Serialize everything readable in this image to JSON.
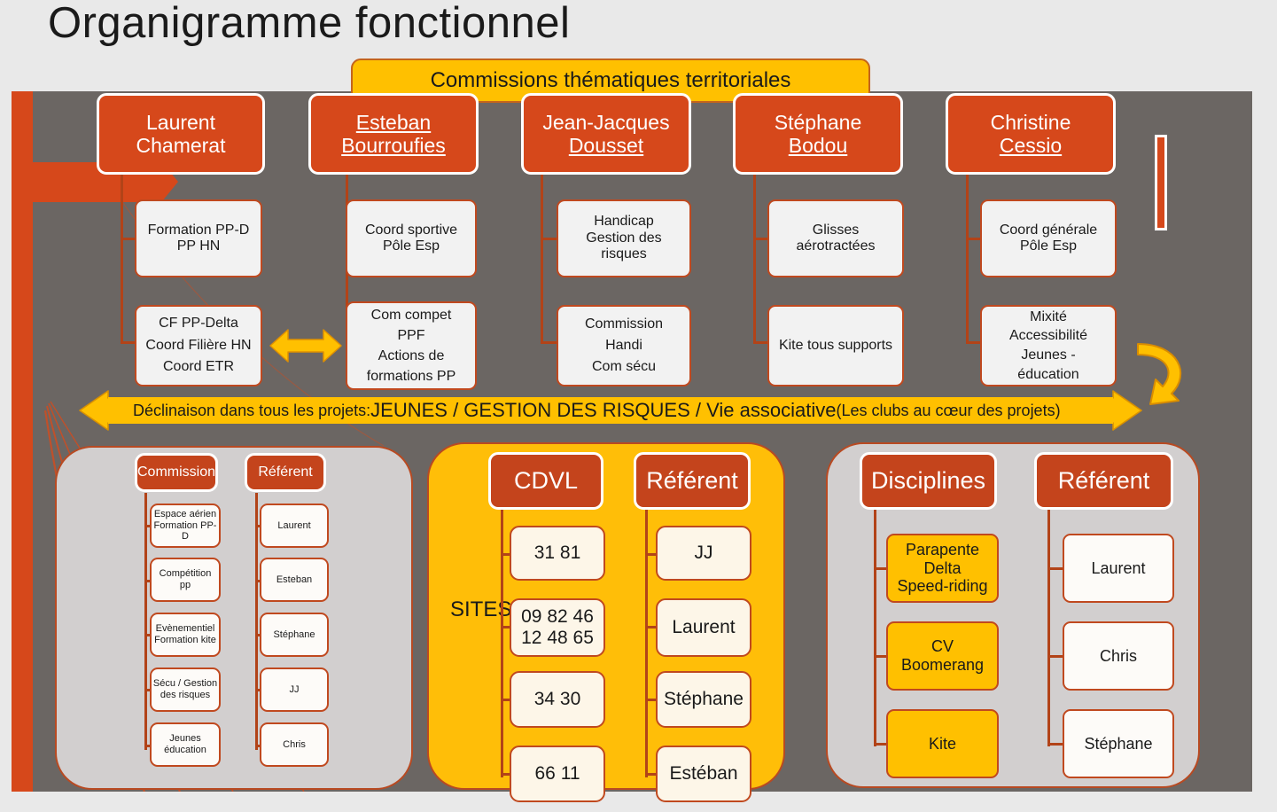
{
  "page": {
    "title": "Organigramme fonctionnel",
    "colors": {
      "orange": "#D6481B",
      "yellow": "#FFC000",
      "gray_stage": "#6B6663",
      "panel_gray": "#D2CFCF",
      "panel_yellow": "#FFBE08",
      "white_box": "#F2F2F2",
      "cream_box": "#FDF6E8",
      "connector": "#B24318",
      "background": "#E9E9E9"
    }
  },
  "top_banner": {
    "label": "Commissions thématiques territoriales"
  },
  "columns": [
    {
      "name": "Laurent Chamerat",
      "sub1": "Formation PP-D\nPP HN",
      "sub1_lines": [
        "Formation PP-D",
        "PP HN"
      ],
      "sub2_lines": [
        "CF PP-Delta",
        "Coord Filière HN",
        "Coord ETR"
      ]
    },
    {
      "name": "Esteban Bourroufies",
      "sub1_lines": [
        "Coord sportive",
        "Pôle Esp"
      ],
      "sub2_lines": [
        "Com compet",
        "PPF",
        "Actions de",
        "formations PP"
      ]
    },
    {
      "name": "Jean-Jacques Dousset",
      "sub1_lines": [
        "Handicap",
        "Gestion des",
        "risques"
      ],
      "sub2_lines": [
        "Commission",
        "Handi",
        "Com sécu"
      ]
    },
    {
      "name": "Stéphane Bodou",
      "sub1_lines": [
        "Glisses",
        "aérotractées"
      ],
      "sub2_lines": [
        "Kite tous supports"
      ]
    },
    {
      "name": "Christine Cessio",
      "sub1_lines": [
        "Coord générale",
        "Pôle Esp"
      ],
      "sub2_lines": [
        "Mixité",
        "Accessibilité",
        "Jeunes -",
        "éducation"
      ]
    }
  ],
  "column_names": {
    "c1_l1": "Laurent",
    "c1_l2": "Chamerat",
    "c2_l1": "Esteban",
    "c2_l2": "Bourroufies",
    "c3_l1": "Jean-Jacques",
    "c3_l2": "Dousset",
    "c4_l1": "Stéphane",
    "c4_l2": "Bodou",
    "c5_l1": "Christine",
    "c5_l2": "Cessio"
  },
  "row1_boxes": {
    "b1": "Formation PP-D\nPP HN",
    "b2": "Coord sportive\nPôle Esp",
    "b3": "Handicap\nGestion des\nrisques",
    "b4": "Glisses\naérotractées",
    "b5": "Coord générale\nPôle Esp"
  },
  "row2_boxes": {
    "b1": "CF PP-Delta\nCoord Filière HN\nCoord ETR",
    "b2": "Com compet\nPPF\nActions de\nformations PP",
    "b3": "Commission\nHandi\nCom sécu",
    "b4": "Kite tous supports",
    "b5": "Mixité\nAccessibilité\nJeunes -\néducation"
  },
  "declinaison_banner": {
    "prefix": "Déclinaison dans tous les projets: ",
    "highlight": "JEUNES  / GESTION DES RISQUES / Vie associative ",
    "suffix": "(Les clubs au cœur des projets)"
  },
  "panel_commission": {
    "header_left": "Commission",
    "header_right": "Référent",
    "commissions": [
      "Espace aérien\nFormation PP-D",
      "Compétition\npp",
      "Evènementiel\nFormation kite",
      "Sécu / Gestion\ndes risques",
      "Jeunes\néducation"
    ],
    "commission_items": {
      "i0_l1": "Espace aérien",
      "i0_l2": "Formation PP-",
      "i0_l3": "D",
      "i1_l1": "Compétition",
      "i1_l2": "pp",
      "i2_l1": "Evènementiel",
      "i2_l2": "Formation kite",
      "i3_l1": "Sécu / Gestion",
      "i3_l2": "des risques",
      "i4_l1": "Jeunes",
      "i4_l2": "éducation"
    },
    "referents": [
      "Laurent",
      "Esteban",
      "Stéphane",
      "JJ",
      "Chris"
    ]
  },
  "panel_cdvl": {
    "header_left": "CDVL",
    "header_right": "Référent",
    "sites_label": "SITES",
    "cdvl_values": [
      "31 81",
      "09 82 46\n12 48 65",
      "34 30",
      "66 11"
    ],
    "cdvl_items": {
      "i0": "31 81",
      "i1_l1": "09 82 46",
      "i1_l2": "12 48 65",
      "i2": "34 30",
      "i3": "66 11"
    },
    "referents": [
      "JJ",
      "Laurent",
      "Stéphane",
      "Estéban"
    ]
  },
  "panel_disciplines": {
    "header_left": "Disciplines",
    "header_right": "Référent",
    "disciplines": [
      "Parapente\nDelta\nSpeed-riding",
      "CV\nBoomerang",
      "Kite"
    ],
    "discipline_items": {
      "d0_l1": "Parapente",
      "d0_l2": "Delta",
      "d0_l3": "Speed-riding",
      "d1_l1": "CV",
      "d1_l2": "Boomerang",
      "d2_l1": "Kite"
    },
    "referents": [
      "Laurent",
      "Chris",
      "Stéphane"
    ]
  }
}
